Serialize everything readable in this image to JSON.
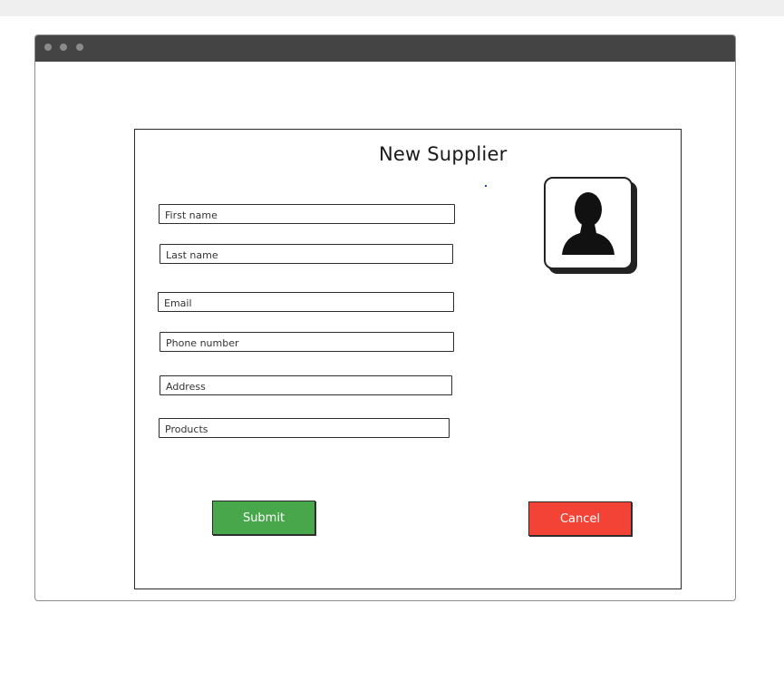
{
  "form": {
    "title": "New Supplier",
    "fields": [
      {
        "placeholder": "First name",
        "value": ""
      },
      {
        "placeholder": "Last name",
        "value": ""
      },
      {
        "placeholder": "Email",
        "value": ""
      },
      {
        "placeholder": "Phone number",
        "value": ""
      },
      {
        "placeholder": "Address",
        "value": ""
      },
      {
        "placeholder": "Products",
        "value": ""
      }
    ],
    "avatar_icon": "user-silhouette-icon",
    "submit_label": "Submit",
    "cancel_label": "Cancel"
  },
  "colors": {
    "submit": "#48a74b",
    "cancel": "#f24336",
    "titlebar": "#444444"
  }
}
